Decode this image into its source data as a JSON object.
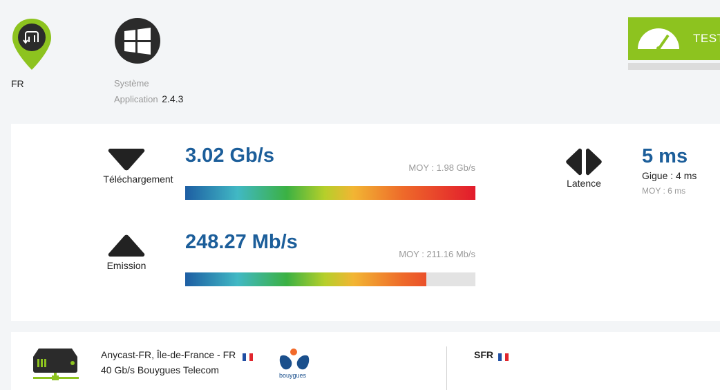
{
  "header": {
    "location_code": "FR",
    "system_label": "Système",
    "app_label": "Application",
    "app_version": "2.4.3",
    "test_button_label": "TEST",
    "os_icon": "windows-icon",
    "location_icon": "map-pin-icon"
  },
  "results": {
    "download": {
      "label": "Téléchargement",
      "value": "3.02 Gb/s",
      "average": "MOY : 1.98 Gb/s",
      "bar_fill_percent": 100
    },
    "upload": {
      "label": "Emission",
      "value": "248.27 Mb/s",
      "average": "MOY : 211.16 Mb/s",
      "bar_fill_percent": 83
    },
    "latency": {
      "label": "Latence",
      "value": "5 ms",
      "jitter": "Gigue : 4 ms",
      "average": "MOY : 6 ms"
    }
  },
  "server": {
    "name": "Anycast-FR, Île-de-France - FR",
    "isp": "40 Gb/s Bouygues Telecom",
    "isp_logo_text": "bouygues",
    "operator": "SFR"
  },
  "colors": {
    "accent_green": "#8dc31f",
    "value_blue": "#1c5e9a",
    "muted_gray": "#9a9a9a"
  }
}
